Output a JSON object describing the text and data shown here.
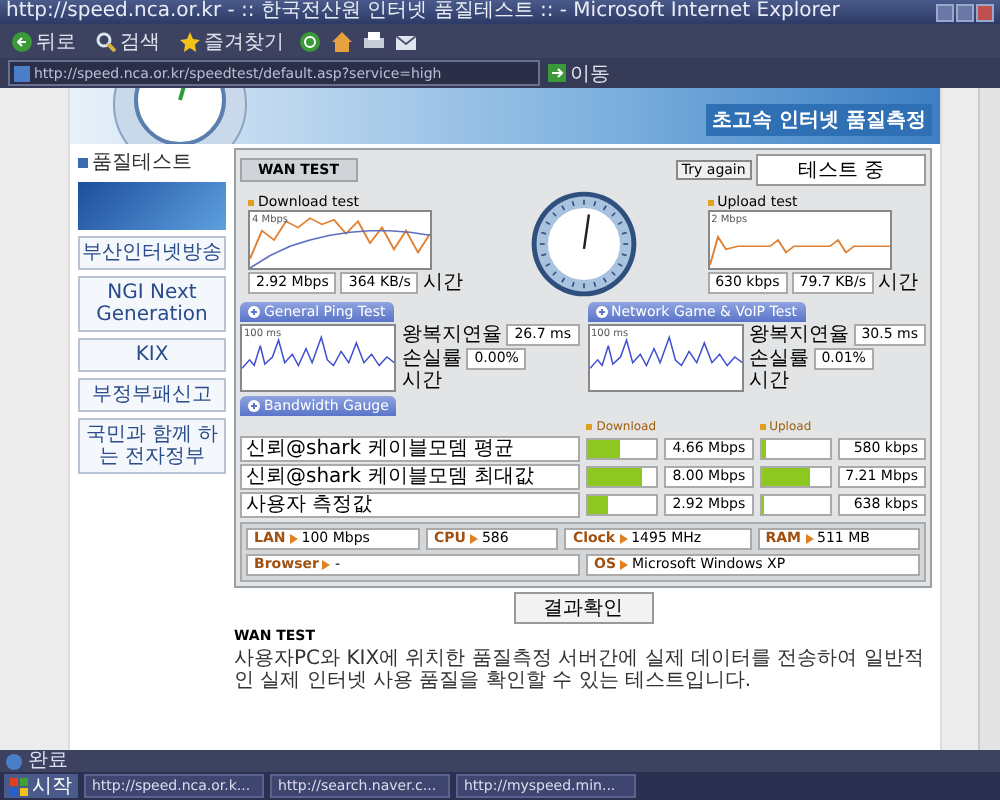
{
  "window": {
    "title": "http://speed.nca.or.kr - :: 한국전산원 인터넷 품질테스트 :: - Microsoft Internet Explorer"
  },
  "toolbar": [
    {
      "label": "뒤로"
    },
    {
      "label": "검색"
    },
    {
      "label": "즐겨찾기"
    }
  ],
  "address_bar": {
    "url": "http://speed.nca.or.kr/speedtest/default.asp?service=high",
    "go": "이동"
  },
  "banner": {
    "title": "초고속 인터넷 품질측정"
  },
  "sidebar": {
    "title": "품질테스트",
    "items": [
      {
        "kind": "image"
      },
      {
        "kind": "text",
        "label": "부산인터넷방송"
      },
      {
        "kind": "text",
        "label": "NGI Next Generation"
      },
      {
        "kind": "text",
        "label": "KIX"
      },
      {
        "kind": "text",
        "label": "부정부패신고"
      },
      {
        "kind": "text",
        "label": "국민과 함께 하는 전자정부"
      }
    ]
  },
  "wan_test": {
    "tab": "WAN TEST",
    "try_again": "Try again",
    "status": "테스트 중",
    "download": {
      "title": "Download test",
      "scale": "4 Mbps",
      "axis": "시간",
      "rate": "2.92 Mbps",
      "bytes": "364 KB/s"
    },
    "upload": {
      "title": "Upload test",
      "scale": "2 Mbps",
      "axis": "시간",
      "rate": "630 kbps",
      "bytes": "79.7 KB/s"
    },
    "ping": [
      {
        "title": "General Ping Test",
        "scale": "100 ms",
        "axis": "시간",
        "delay_label": "왕복지연율",
        "delay": "26.7 ms",
        "loss_label": "손실률",
        "loss": "0.00%"
      },
      {
        "title": "Network Game & VoIP Test",
        "scale": "100 ms",
        "axis": "시간",
        "delay_label": "왕복지연율",
        "delay": "30.5 ms",
        "loss_label": "손실률",
        "loss": "0.01%"
      }
    ],
    "bandwidth": {
      "title": "Bandwidth Gauge",
      "download_label": "Download",
      "upload_label": "Upload",
      "rows": [
        {
          "label": "신뢰@shark 케이블모뎀 평균",
          "download": {
            "level": 0.47,
            "reading": "4.66 Mbps"
          },
          "upload": {
            "level": 0.06,
            "reading": "580 kbps"
          }
        },
        {
          "label": "신뢰@shark 케이블모뎀 최대값",
          "download": {
            "level": 0.8,
            "reading": "8.00 Mbps"
          },
          "upload": {
            "level": 0.72,
            "reading": "7.21 Mbps"
          }
        },
        {
          "label": "사용자 측정값",
          "download": {
            "level": 0.3,
            "reading": "2.92 Mbps"
          },
          "upload": {
            "level": 0.04,
            "reading": "638 kbps"
          }
        }
      ]
    },
    "system": [
      {
        "name": "LAN",
        "value": "100 Mbps"
      },
      {
        "name": "CPU",
        "value": "586"
      },
      {
        "name": "Clock",
        "value": "1495 MHz"
      },
      {
        "name": "RAM",
        "value": "511 MB"
      },
      {
        "name": "Browser",
        "value": "-"
      },
      {
        "name": "OS",
        "value": "Microsoft Windows XP"
      }
    ]
  },
  "result_button": "결과확인",
  "article": [
    {
      "heading": "WAN TEST",
      "text": "사용자PC와 KIX에 위치한 품질측정 서버간에 실제 데이터를 전송하여 일반적인 실제 인터넷 사용 품질을 확인할 수 있는 테스트입니다."
    }
  ],
  "status_bar": {
    "text": "완료"
  },
  "taskbar": {
    "start": "시작",
    "tasks": [
      "http://speed.nca.or.k...",
      "http://search.naver.c...",
      "http://myspeed.min..."
    ]
  }
}
